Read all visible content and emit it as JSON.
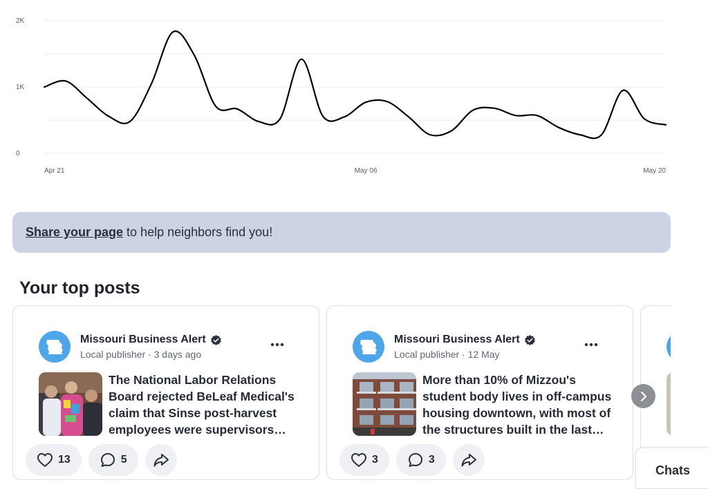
{
  "chart_data": {
    "type": "line",
    "title": "",
    "xlabel": "",
    "ylabel": "",
    "ylim": [
      0,
      2000
    ],
    "yticks": [
      0,
      1000,
      2000
    ],
    "ytick_labels": [
      "0",
      "1K",
      "2K"
    ],
    "xtick_labels": [
      "Apr 21",
      "May 06",
      "May 20"
    ],
    "grid": true,
    "x": [
      "Apr 21",
      "Apr 22",
      "Apr 23",
      "Apr 24",
      "Apr 25",
      "Apr 26",
      "Apr 27",
      "Apr 28",
      "Apr 29",
      "Apr 30",
      "May 01",
      "May 02",
      "May 03",
      "May 04",
      "May 05",
      "May 06",
      "May 07",
      "May 08",
      "May 09",
      "May 10",
      "May 11",
      "May 12",
      "May 13",
      "May 14",
      "May 15",
      "May 16",
      "May 17",
      "May 18",
      "May 19",
      "May 20"
    ],
    "series": [
      {
        "values": [
          1000,
          1090,
          830,
          560,
          480,
          1050,
          1830,
          1480,
          710,
          670,
          480,
          520,
          1420,
          560,
          550,
          770,
          780,
          550,
          280,
          340,
          650,
          680,
          570,
          570,
          390,
          280,
          280,
          950,
          520,
          430
        ]
      }
    ]
  },
  "banner": {
    "link_text": "Share your page",
    "rest_text": "to help neighbors find you!"
  },
  "section_title": "Your top posts",
  "posts": [
    {
      "publisher": "Missouri Business Alert",
      "meta": "Local publisher · 3 days ago",
      "text": "The National Labor Relations Board rejected BeLeaf Medical's claim that Sinse post-harvest employees were supervisors and ordered a union election.",
      "likes": "13",
      "comments": "5"
    },
    {
      "publisher": "Missouri Business Alert",
      "meta": "Local publisher · 12 May",
      "text": "More than 10% of Mizzou's student body lives in off-campus housing downtown, with most of the structures built in the last decade.",
      "likes": "3",
      "comments": "3"
    }
  ],
  "chats_label": "Chats",
  "colors": {
    "avatar": "#4ea6e8",
    "banner": "#cdd3e3",
    "line": "#000000"
  },
  "icons": [
    "missouri-state-icon",
    "verified-badge-icon",
    "more-icon",
    "heart-icon",
    "comment-icon",
    "share-icon",
    "chevron-right-icon"
  ]
}
